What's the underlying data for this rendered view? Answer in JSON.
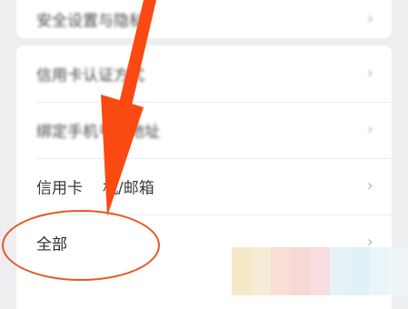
{
  "menu": {
    "top_item": {
      "label": "安全设置与隐私",
      "blurred": true
    },
    "items": [
      {
        "label": "信用卡认证方式",
        "blurred": true
      },
      {
        "label": "绑定手机号与地址",
        "blurred": true
      },
      {
        "label_visible_a": "信用卡",
        "label_visible_b": "机/邮箱",
        "blurred": false
      },
      {
        "label": "全部",
        "blurred": false
      }
    ],
    "chevron_icon": "›"
  },
  "annotation": {
    "arrow_color": "#fa4a12",
    "circle_color": "#e45a24",
    "circled_item": "全部"
  },
  "pixelation_colors": [
    "#f1e3b6",
    "#f2e6c8",
    "#f7d3c9",
    "#f3cbc6",
    "#f6d0d4",
    "#dfeef6",
    "#d6ecf6",
    "#e3f1f7",
    "#eef5f7"
  ]
}
